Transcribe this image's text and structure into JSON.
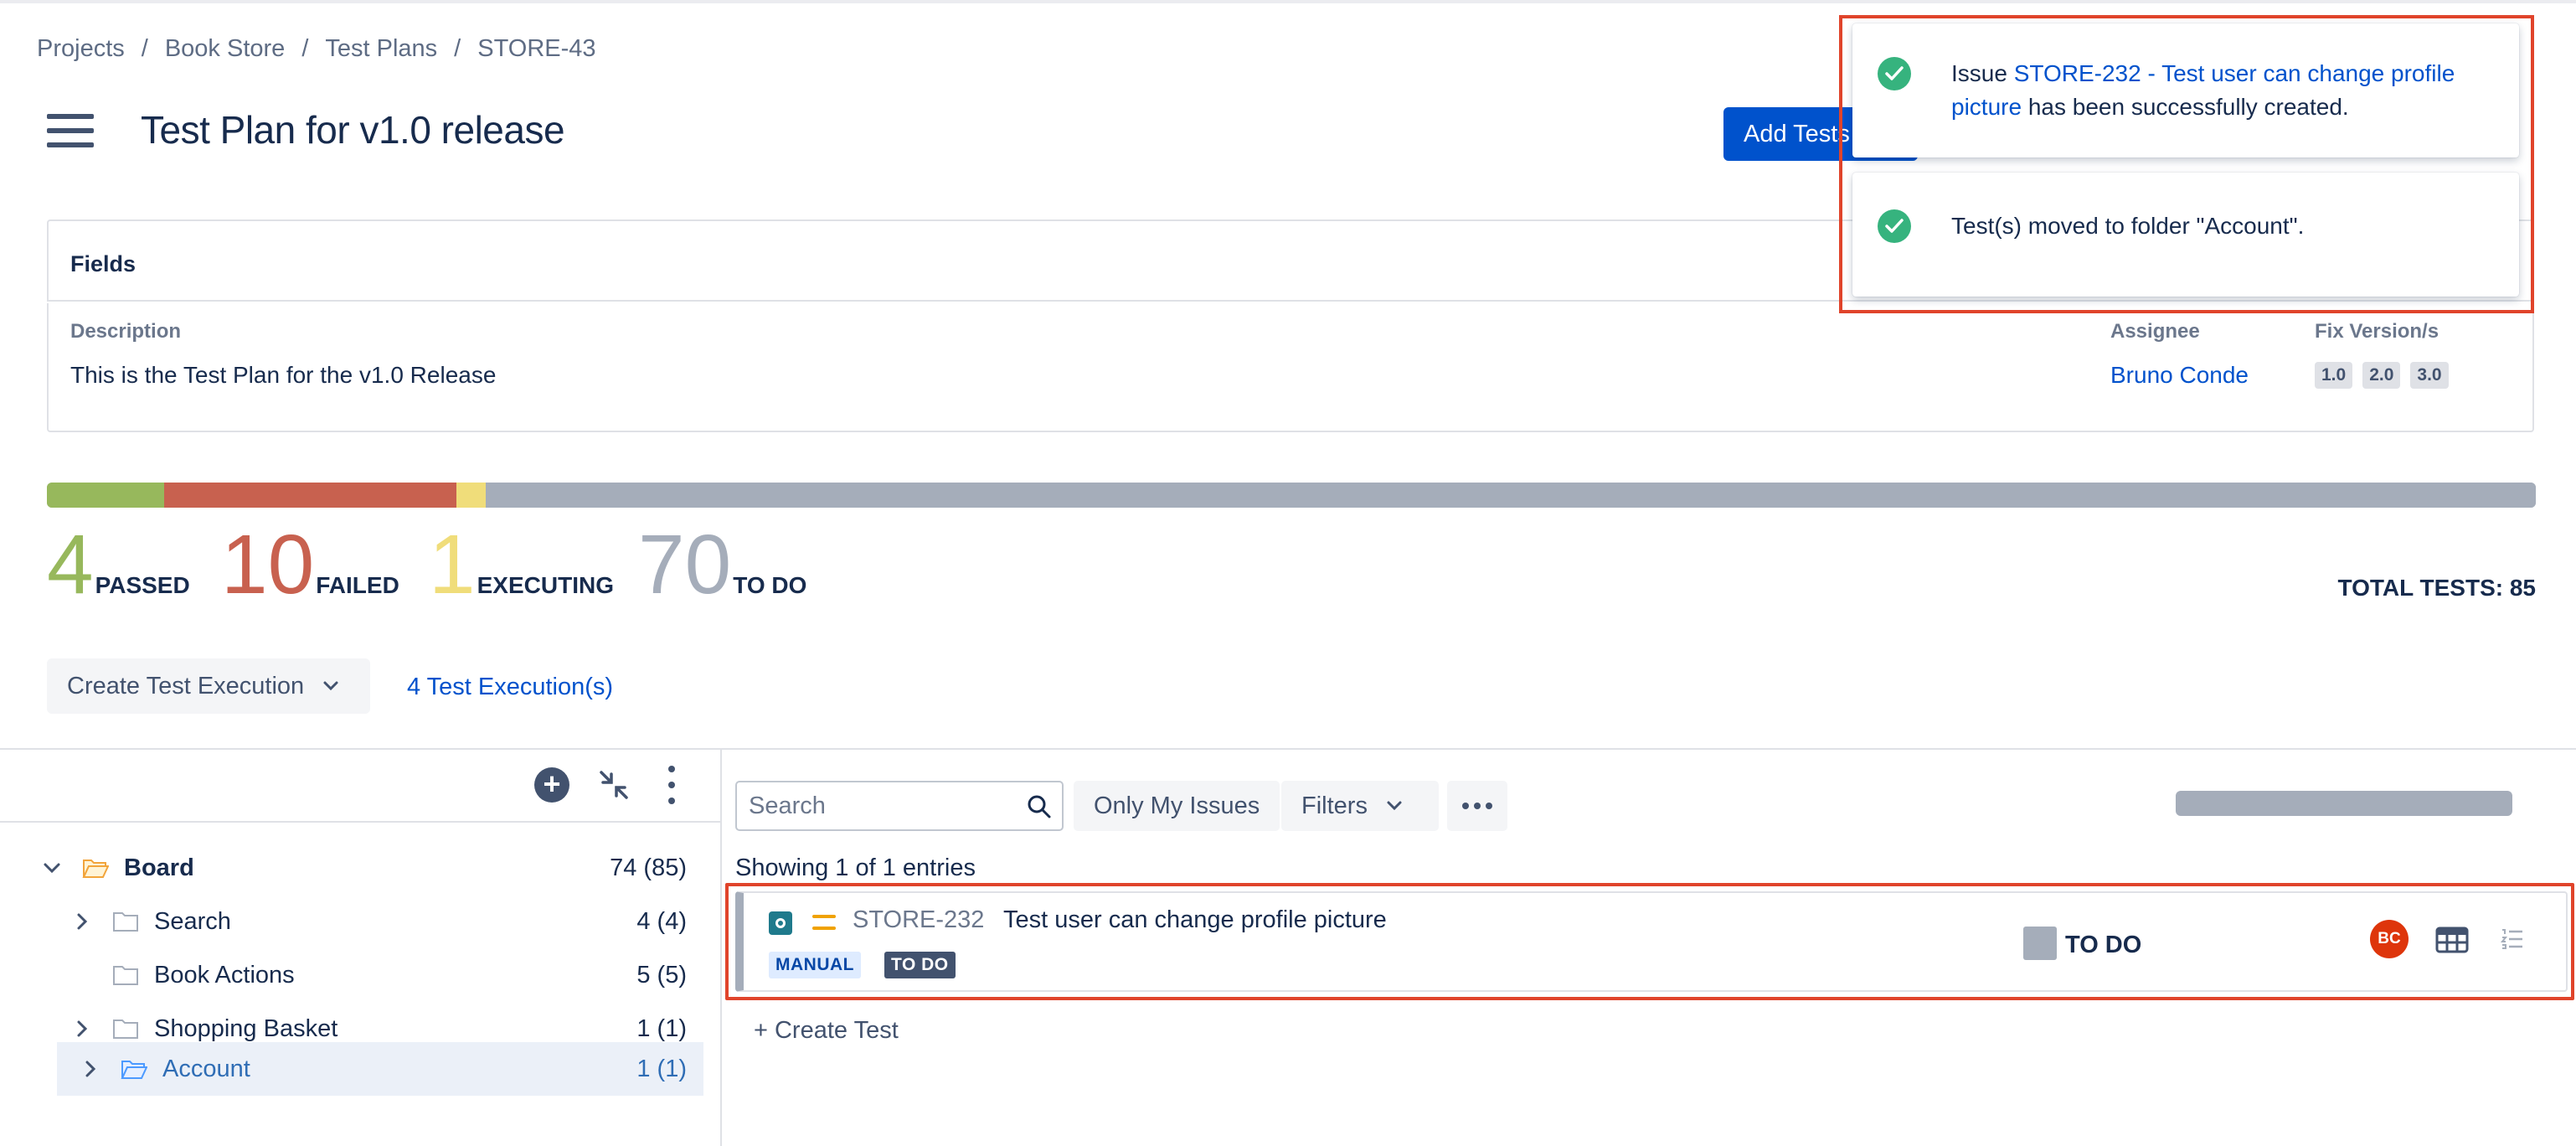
{
  "breadcrumb": [
    "Projects",
    "Book Store",
    "Test Plans",
    "STORE-43"
  ],
  "header": {
    "title": "Test Plan for v1.0 release",
    "add_tests_label": "Add Tests"
  },
  "fields": {
    "section_label": "Fields",
    "description_label": "Description",
    "description_value": "This is the Test Plan for the v1.0 Release",
    "assignee_label": "Assignee",
    "assignee_value": "Bruno Conde",
    "fix_versions_label": "Fix Version/s",
    "fix_versions": [
      "1.0",
      "2.0",
      "3.0"
    ]
  },
  "stats": {
    "passed": {
      "count": "4",
      "label": "PASSED",
      "color": "#97b85c"
    },
    "failed": {
      "count": "10",
      "label": "FAILED",
      "color": "#c8614f"
    },
    "executing": {
      "count": "1",
      "label": "EXECUTING",
      "color": "#f0dd7a"
    },
    "todo": {
      "count": "70",
      "label": "TO DO",
      "color": "#a5adba"
    },
    "total_label": "TOTAL TESTS: 85",
    "total": 85
  },
  "actions": {
    "create_execution_label": "Create Test Execution",
    "executions_link": "4 Test Execution(s)"
  },
  "tree": {
    "items": [
      {
        "name": "Board",
        "count": "74 (85)"
      },
      {
        "name": "Search",
        "count": "4 (4)"
      },
      {
        "name": "Book Actions",
        "count": "5 (5)"
      },
      {
        "name": "Shopping Basket",
        "count": "1 (1)"
      },
      {
        "name": "Account",
        "count": "1 (1)"
      }
    ]
  },
  "toolbar": {
    "search_placeholder": "Search",
    "only_my_issues_label": "Only My Issues",
    "filters_label": "Filters"
  },
  "list": {
    "showing_text": "Showing 1 of 1 entries",
    "rows": [
      {
        "key": "STORE-232",
        "summary": "Test user can change profile picture",
        "type_tag": "MANUAL",
        "status_tag": "TO DO",
        "status": "TO DO",
        "assignee_initials": "BC"
      }
    ],
    "create_test_label": "+ Create Test"
  },
  "notifications": [
    {
      "prefix": "Issue ",
      "link": "STORE-232 - Test user can change profile picture",
      "suffix": " has been successfully created."
    },
    {
      "text": "Test(s) moved to folder \"Account\"."
    }
  ],
  "colors": {
    "accent": "#0052cc",
    "highlight": "#e0442b",
    "success": "#36b37e"
  }
}
